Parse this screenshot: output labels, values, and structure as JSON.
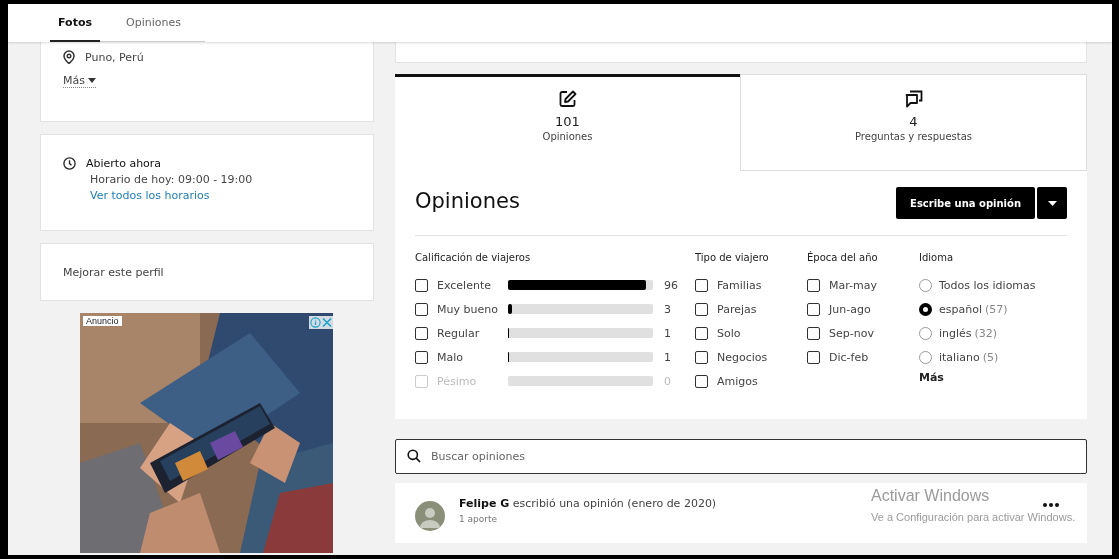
{
  "top_tabs": [
    {
      "label": "Fotos",
      "selected": true
    },
    {
      "label": "Opiniones",
      "selected": false
    }
  ],
  "location": {
    "text": "Puno, Perú",
    "more": "Más"
  },
  "hours": {
    "status": "Abierto ahora",
    "today": "Horario de hoy: 09:00 - 19:00",
    "link": "Ver todos los horarios"
  },
  "improve_profile": "Mejorar este perfil",
  "ad": {
    "label": "Anuncio"
  },
  "section_tabs": [
    {
      "kind": "reviews",
      "count": "101",
      "label": "Opiniones",
      "selected": true
    },
    {
      "kind": "qa",
      "count": "4",
      "label": "Preguntas y respuestas",
      "selected": false
    }
  ],
  "reviews": {
    "title": "Opiniones",
    "write_button": "Escribe una opinión",
    "rating_filter": {
      "heading": "Calificación de viajeros",
      "items": [
        {
          "label": "Excelente",
          "count": "96",
          "level": 0.95,
          "checked": false,
          "disabled": false
        },
        {
          "label": "Muy bueno",
          "count": "3",
          "level": 0.03,
          "checked": false,
          "disabled": false
        },
        {
          "label": "Regular",
          "count": "1",
          "level": 0.01,
          "checked": false,
          "disabled": false
        },
        {
          "label": "Malo",
          "count": "1",
          "level": 0.01,
          "checked": false,
          "disabled": false
        },
        {
          "label": "Pésimo",
          "count": "0",
          "level": 0,
          "checked": false,
          "disabled": true
        }
      ]
    },
    "traveler_type": {
      "heading": "Tipo de viajero",
      "items": [
        {
          "label": "Familias",
          "checked": false
        },
        {
          "label": "Parejas",
          "checked": false
        },
        {
          "label": "Solo",
          "checked": false
        },
        {
          "label": "Negocios",
          "checked": false
        },
        {
          "label": "Amigos",
          "checked": false
        }
      ]
    },
    "season": {
      "heading": "Época del año",
      "items": [
        {
          "label": "Mar-may",
          "checked": false
        },
        {
          "label": "Jun-ago",
          "checked": false
        },
        {
          "label": "Sep-nov",
          "checked": false
        },
        {
          "label": "Dic-feb",
          "checked": false
        }
      ]
    },
    "language": {
      "heading": "Idioma",
      "options": [
        {
          "label": "Todos los idiomas",
          "selected": false
        },
        {
          "label": "español",
          "count": "(57)",
          "selected": true
        },
        {
          "label": "inglés",
          "count": "(32)",
          "selected": false
        },
        {
          "label": "italiano",
          "count": "(5)",
          "selected": false
        }
      ],
      "more": "Más"
    },
    "search": {
      "placeholder": "Buscar opiniones"
    },
    "review": {
      "byline": "**Felipe G** escribió una opinión (enero de 2020)",
      "contributions": "1 aporte"
    }
  },
  "os_watermark": {
    "title": "Activar Windows",
    "subtitle": "Ve a Configuración para activar Windows."
  }
}
